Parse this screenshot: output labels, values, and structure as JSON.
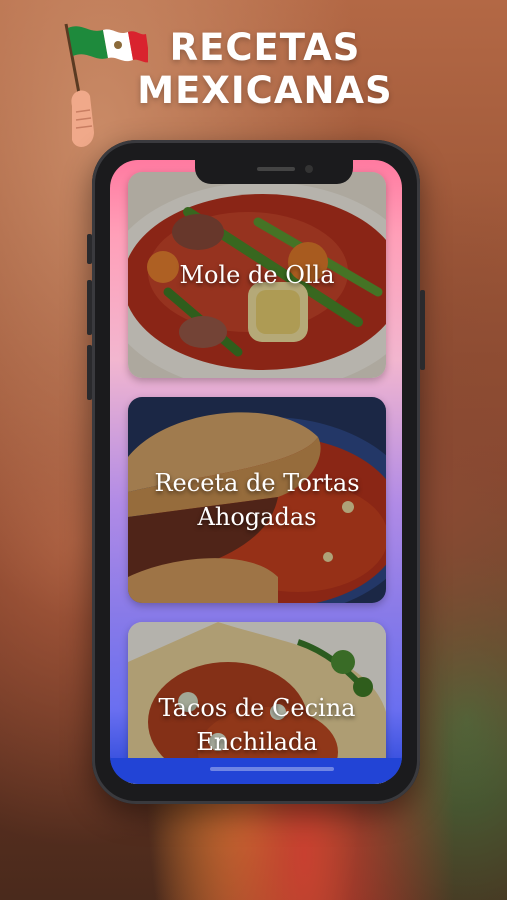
{
  "header": {
    "title_line1": "RECETAS",
    "title_line2": "MEXICANAS",
    "flag_icon": "mexico-flag-icon"
  },
  "recipes": [
    {
      "label": "Mole de Olla"
    },
    {
      "label": "Receta de Tortas Ahogadas"
    },
    {
      "label": "Tacos de Cecina Enchilada"
    }
  ],
  "colors": {
    "flag_green": "#1e8a3c",
    "flag_white": "#ffffff",
    "flag_red": "#d9232e",
    "accent_blue": "#2244d6",
    "accent_pink": "#ff7aa0"
  }
}
